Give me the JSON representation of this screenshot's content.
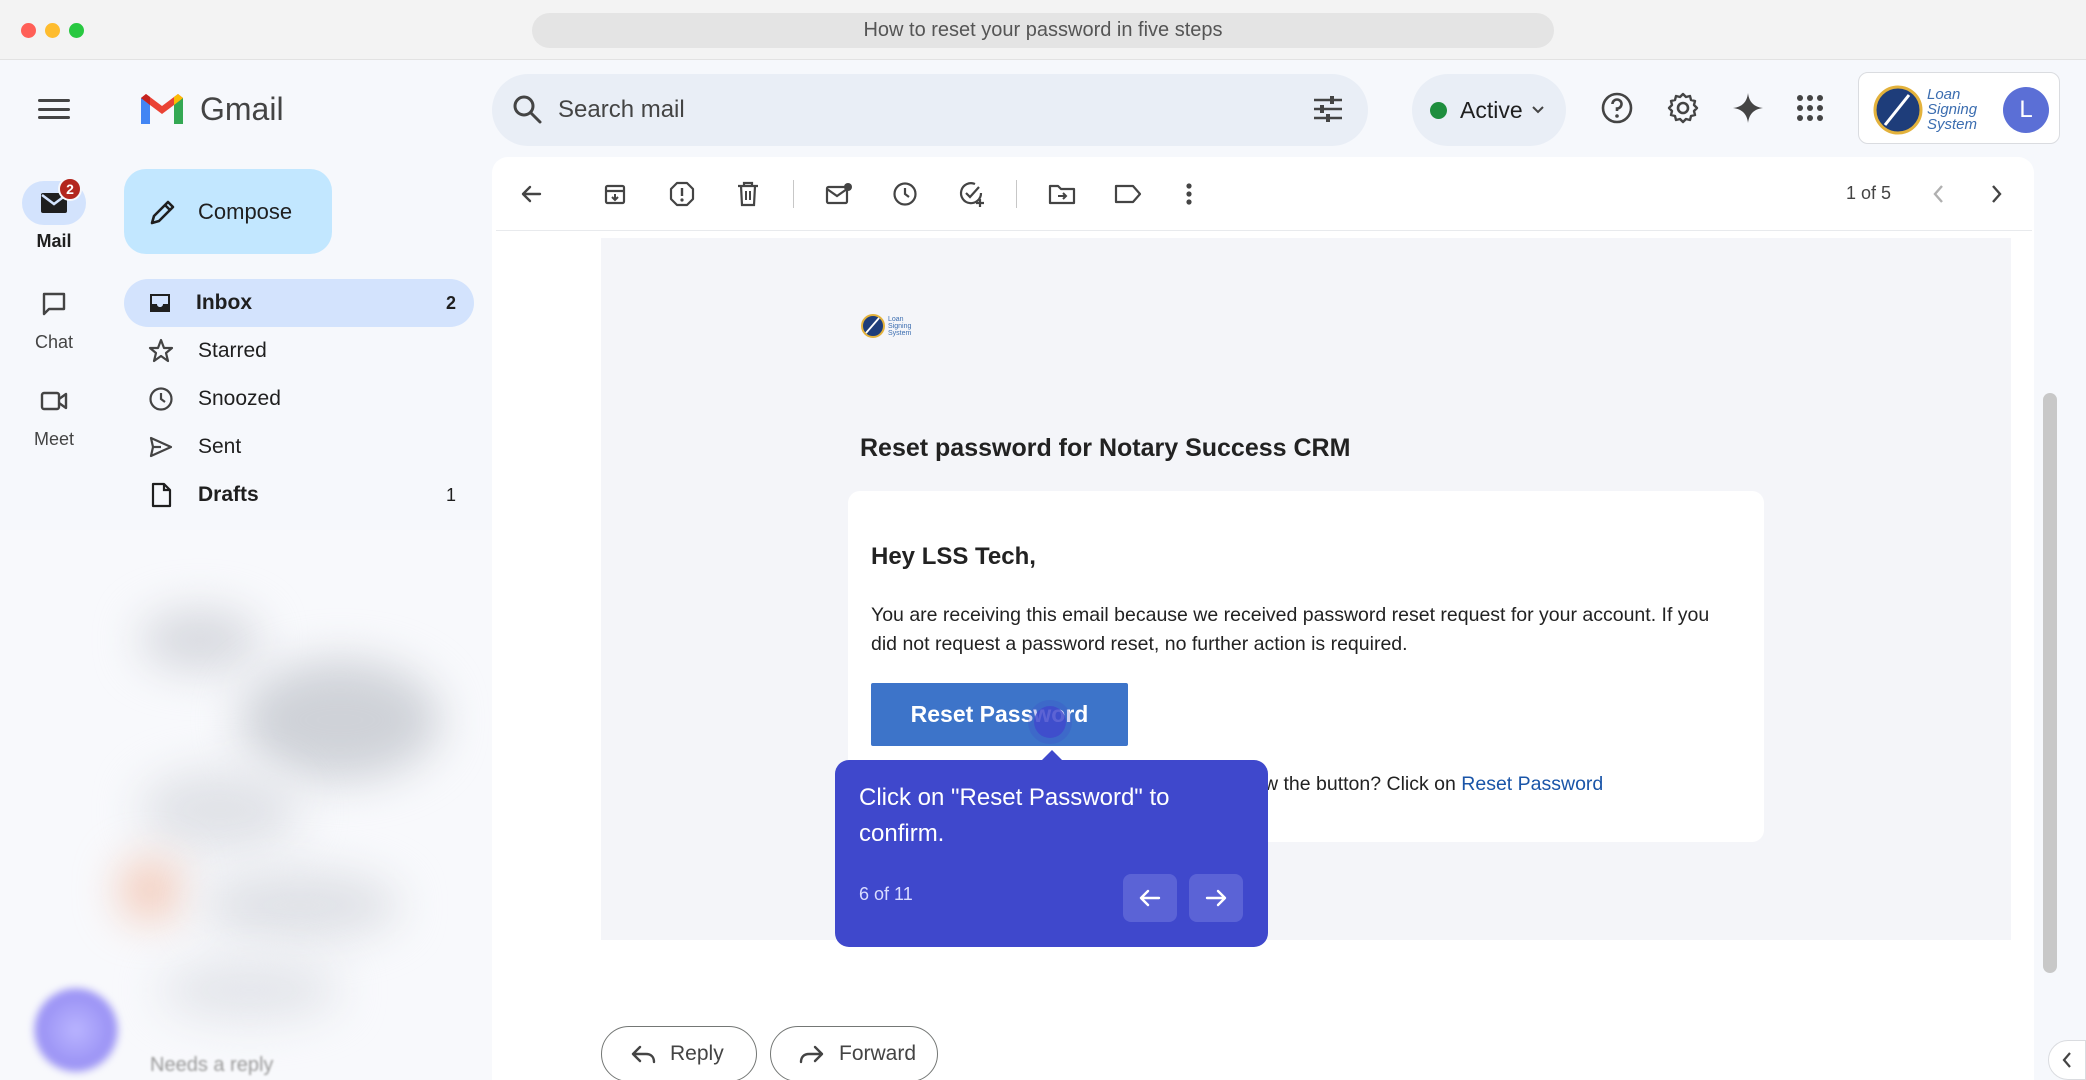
{
  "window": {
    "title": "How to reset your password in five steps"
  },
  "app": {
    "name": "Gmail"
  },
  "rail": {
    "items": [
      {
        "label": "Mail",
        "badge": "2",
        "icon": "mail-icon"
      },
      {
        "label": "Chat",
        "icon": "chat-icon"
      },
      {
        "label": "Meet",
        "icon": "video-icon"
      }
    ]
  },
  "search": {
    "placeholder": "Search mail"
  },
  "status": {
    "label": "Active",
    "color": "#1e8e3e"
  },
  "account": {
    "org_logo_text": "Loan Signing System",
    "avatar_letter": "L"
  },
  "compose": {
    "label": "Compose"
  },
  "nav": {
    "items": [
      {
        "label": "Inbox",
        "count": "2",
        "icon": "inbox-icon"
      },
      {
        "label": "Starred",
        "count": "",
        "icon": "star-icon"
      },
      {
        "label": "Snoozed",
        "count": "",
        "icon": "clock-icon"
      },
      {
        "label": "Sent",
        "count": "",
        "icon": "send-icon"
      },
      {
        "label": "Drafts",
        "count": "1",
        "icon": "draft-icon"
      }
    ],
    "blurred_item": "Needs a reply"
  },
  "toolbar": {
    "pager": "1 of 5"
  },
  "email": {
    "logo_text": "Loan Signing System",
    "title": "Reset password for Notary Success CRM",
    "greeting": "Hey LSS Tech,",
    "body": "You are receiving this email because we received password reset request for your account. If you did not request a password reset, no further action is required.",
    "button_label": "Reset Password",
    "fallback_text": "w the button? Click on",
    "fallback_link": "Reset Password"
  },
  "tooltip": {
    "text": "Click on \"Reset Password\" to confirm.",
    "step": "6 of 11"
  },
  "actions": {
    "reply": "Reply",
    "forward": "Forward"
  },
  "colors": {
    "accent": "#3f48cc",
    "button": "#3d74c9",
    "compose": "#c2e7ff",
    "nav_active": "#d3e3fd"
  }
}
